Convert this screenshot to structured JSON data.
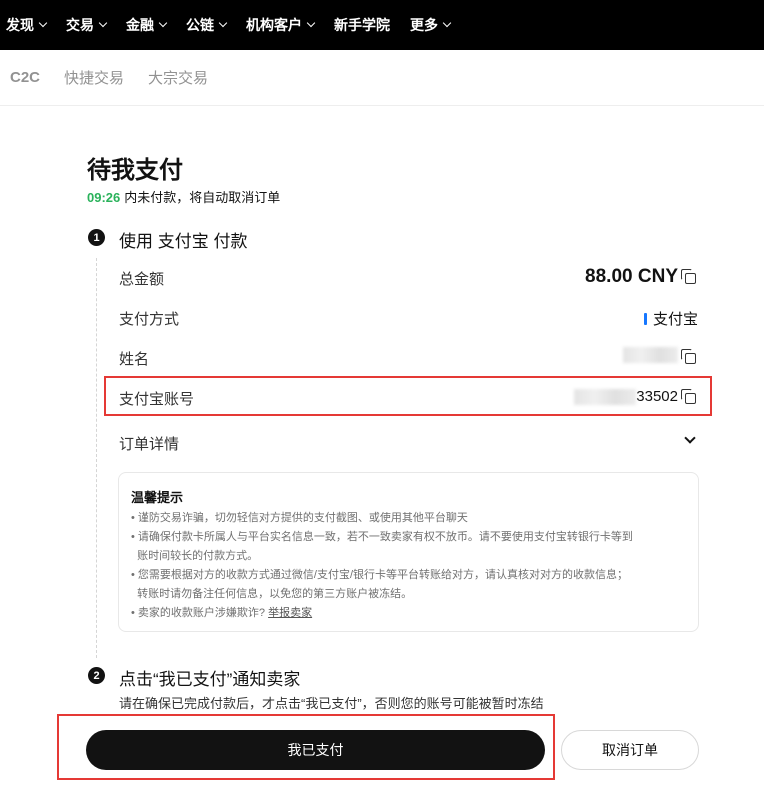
{
  "nav": {
    "items": [
      {
        "label": "发现",
        "dropdown": true
      },
      {
        "label": "交易",
        "dropdown": true
      },
      {
        "label": "金融",
        "dropdown": true
      },
      {
        "label": "公链",
        "dropdown": true
      },
      {
        "label": "机构客户",
        "dropdown": true
      },
      {
        "label": "新手学院",
        "dropdown": false
      },
      {
        "label": "更多",
        "dropdown": true
      }
    ]
  },
  "subnav": {
    "items": [
      "C2C",
      "快捷交易",
      "大宗交易"
    ]
  },
  "order": {
    "title": "待我支付",
    "countdown_time": "09:26",
    "countdown_text": "内未付款，将自动取消订单"
  },
  "step1": {
    "number": "1",
    "title": "使用 支付宝 付款",
    "rows": {
      "total_label": "总金额",
      "total_value": "88.00 CNY",
      "method_label": "支付方式",
      "method_value": "支付宝",
      "name_label": "姓名",
      "name_value_visible": "",
      "account_label": "支付宝账号",
      "account_value_visible": "33502"
    },
    "details_label": "订单详情"
  },
  "tips": {
    "title": "温馨提示",
    "items": [
      "• 谨防交易诈骗，切勿轻信对方提供的支付截图、或使用其他平台聊天",
      "• 请确保付款卡所属人与平台实名信息一致，若不一致卖家有权不放币。请不要使用支付宝转银行卡等到",
      "  账时间较长的付款方式。",
      "• 您需要根据对方的收款方式通过微信/支付宝/银行卡等平台转账给对方，请认真核对对方的收款信息；",
      "  转账时请勿备注任何信息，以免您的第三方账户被冻结。"
    ],
    "last_prefix": "• 卖家的收款账户涉嫌欺诈?",
    "last_link": "举报卖家"
  },
  "step2": {
    "number": "2",
    "title": "点击“我已支付”通知卖家",
    "desc": "请在确保已完成付款后，才点击“我已支付”，否则您的账号可能被暂时冻结"
  },
  "buttons": {
    "paid": "我已支付",
    "cancel": "取消订单"
  },
  "colors": {
    "nav_bg": "#000000",
    "countdown": "#2ab25b",
    "alipay_accent": "#1677ff",
    "highlight_box": "#e53935",
    "primary_button": "#121212"
  }
}
